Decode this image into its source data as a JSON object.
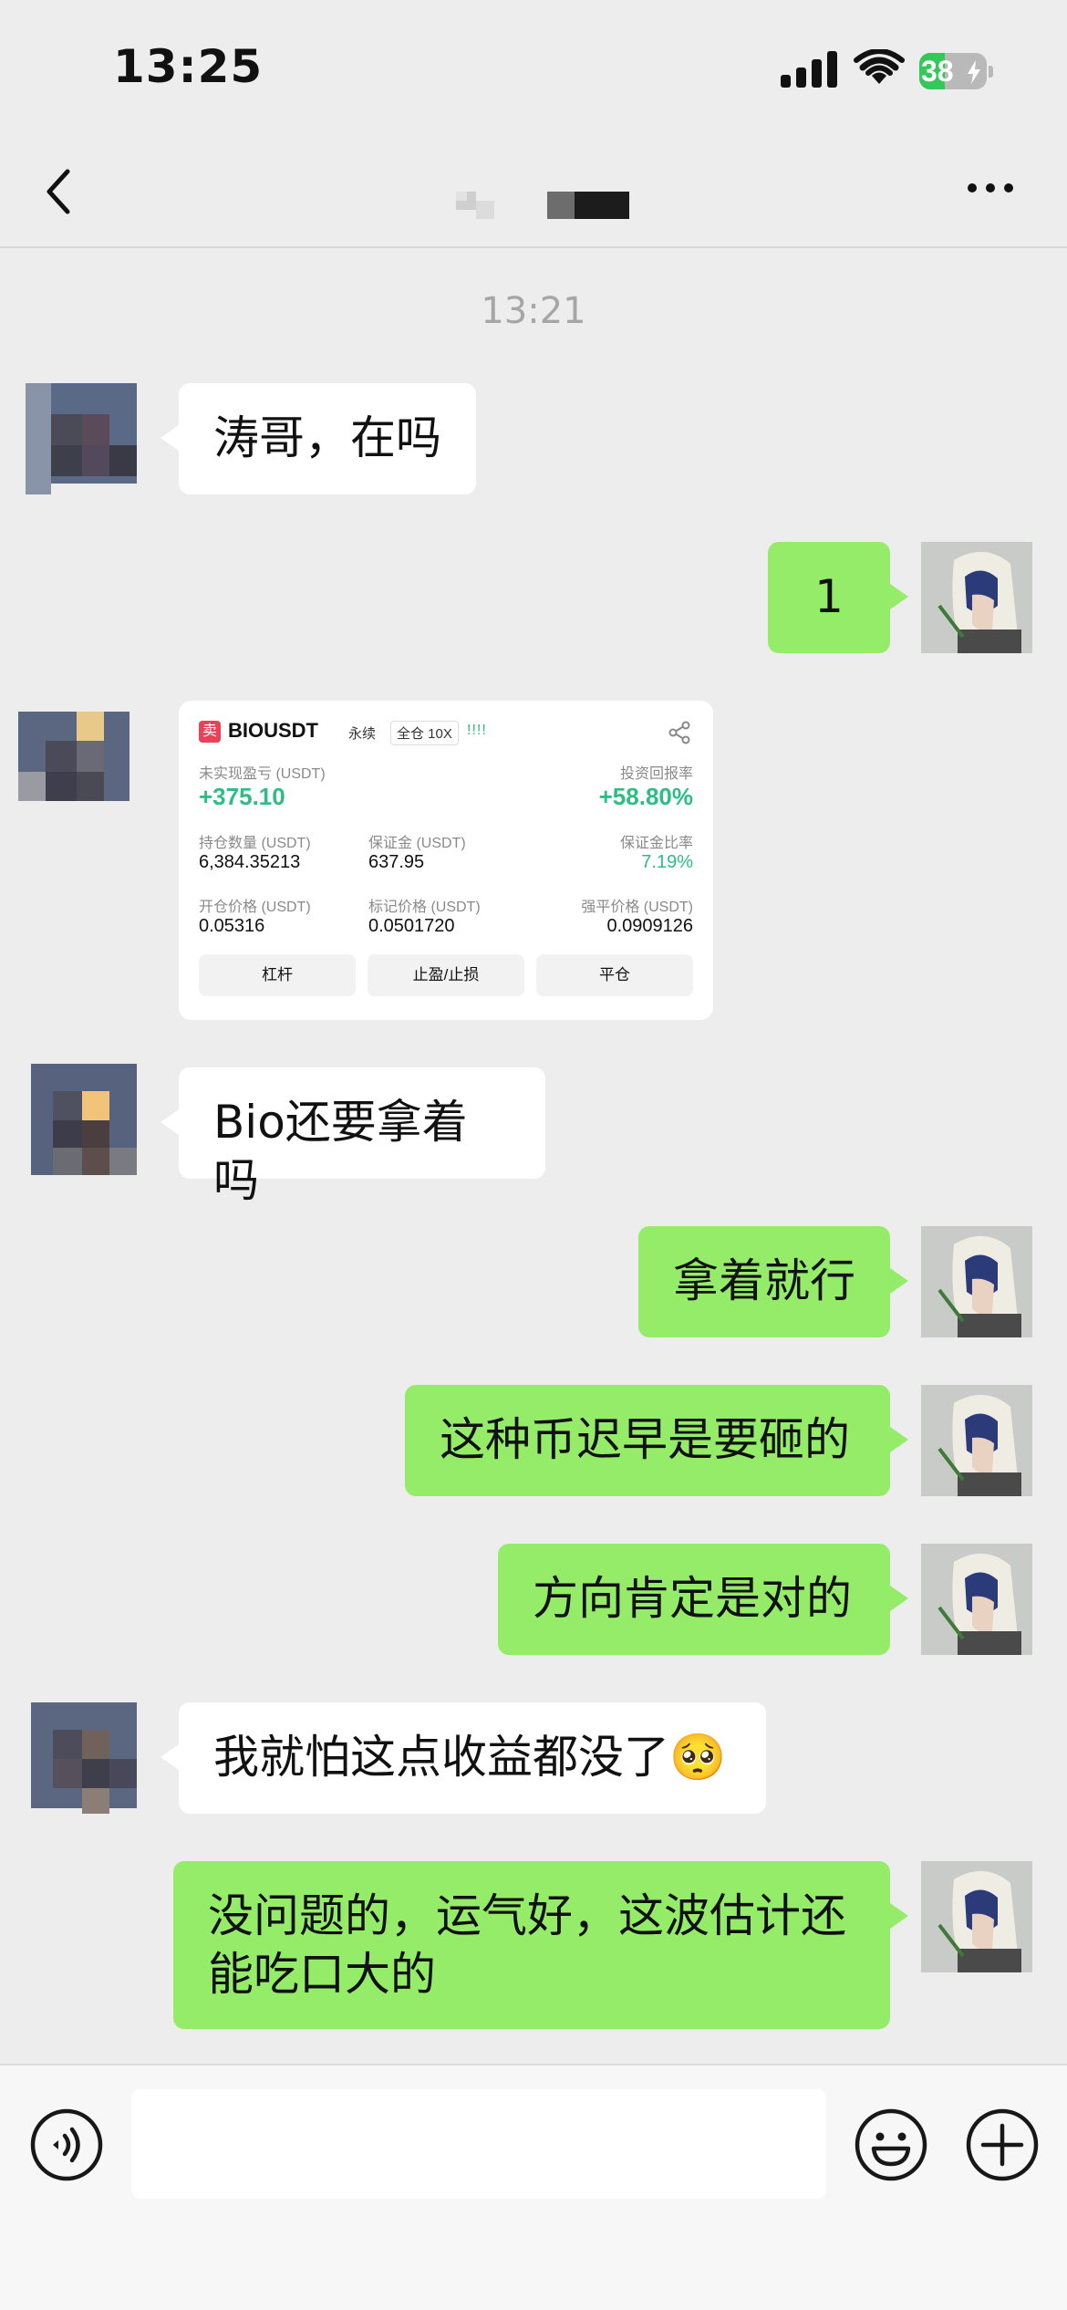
{
  "status_bar": {
    "time": "13:25",
    "battery": "38",
    "battery_level": 0.38
  },
  "nav": {
    "title": ""
  },
  "chat": {
    "timestamp": "13:21",
    "messages": [
      {
        "side": "left",
        "text": "涛哥，在吗"
      },
      {
        "side": "right",
        "text": "1"
      },
      {
        "side": "left",
        "type": "image-card"
      },
      {
        "side": "left",
        "text": "Bio还要拿着吗"
      },
      {
        "side": "right",
        "text": "拿着就行"
      },
      {
        "side": "right",
        "text": "这种币迟早是要砸的"
      },
      {
        "side": "right",
        "text": "方向肯定是对的"
      },
      {
        "side": "left",
        "text": "我就怕这点收益都没了🥺"
      },
      {
        "side": "right",
        "text_line1": "没问题的，运气好，这波估计还",
        "text_line2": "能吃口大的"
      }
    ]
  },
  "trade_card": {
    "sell_tag": "卖",
    "symbol": "BIOUSDT",
    "perp_tag": "永续",
    "margin_tag": "全仓 10X",
    "bars": "!!!!",
    "unrealized_label": "未实现盈亏 (USDT)",
    "unrealized_value": "+375.10",
    "roi_label": "投资回报率",
    "roi_value": "+58.80%",
    "position_label": "持仓数量 (USDT)",
    "position_value": "6,384.35213",
    "margin_label": "保证金 (USDT)",
    "margin_value": "637.95",
    "margin_ratio_label": "保证金比率",
    "margin_ratio_value": "7.19%",
    "entry_label": "开仓价格 (USDT)",
    "entry_value": "0.05316",
    "mark_label": "标记价格 (USDT)",
    "mark_value": "0.0501720",
    "liq_label": "强平价格 (USDT)",
    "liq_value": "0.0909126",
    "buttons": [
      "杠杆",
      "止盈/止损",
      "平仓"
    ]
  },
  "input": {
    "value": "",
    "placeholder": ""
  },
  "colors": {
    "accent_green": "#95ec69",
    "profit_green": "#2ebd85",
    "background": "#ededed"
  },
  "icons": [
    "back-icon",
    "more-icon",
    "share-icon",
    "voice-icon",
    "emoji-icon",
    "plus-icon"
  ]
}
